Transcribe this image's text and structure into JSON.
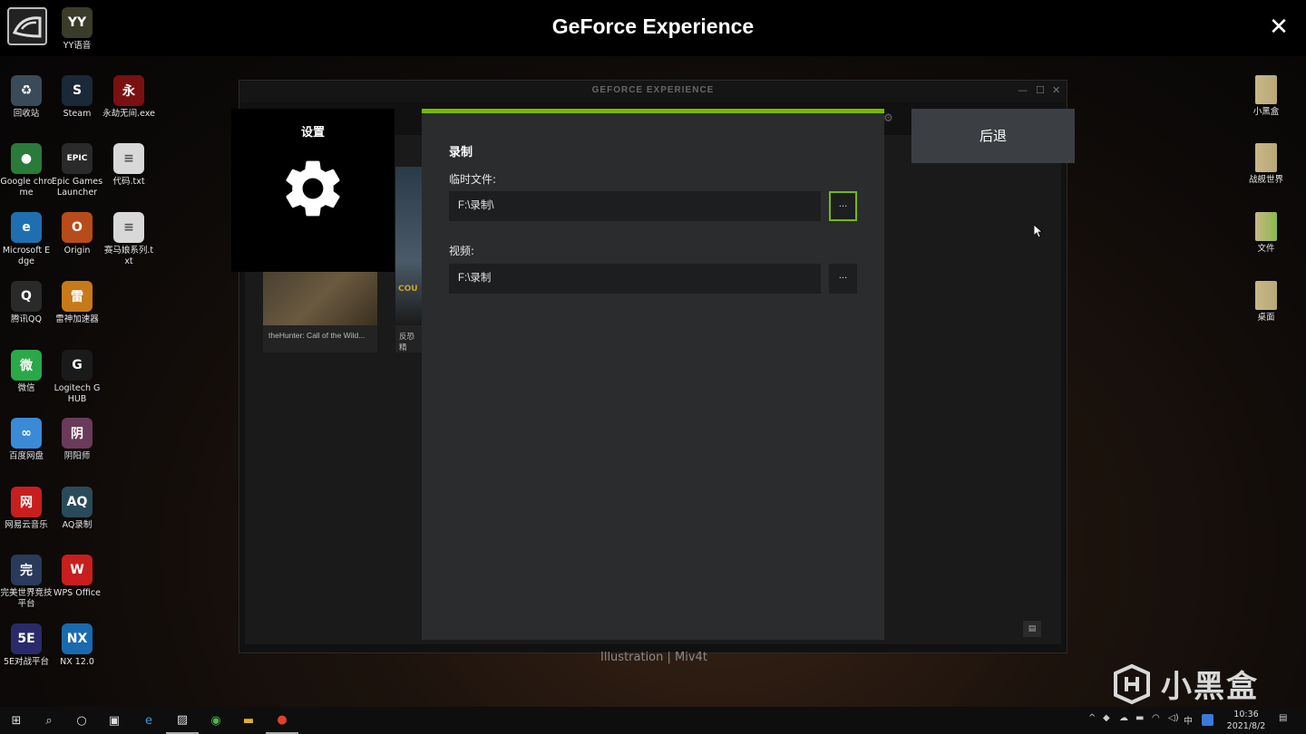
{
  "overlay": {
    "title": "GeForce Experience",
    "close_label": "✕"
  },
  "gfe_window": {
    "logo_text": "GEFORCE EXPERIENCE",
    "game_cards": [
      {
        "caption": "theHunter: Call of the Wild..."
      },
      {
        "caption": "反恐精",
        "art_text": "COU"
      }
    ]
  },
  "settings_panel": {
    "title": "设置"
  },
  "dialog": {
    "section_title": "录制",
    "temp_label": "临时文件:",
    "temp_value": "F:\\录制\\",
    "video_label": "视频:",
    "video_value": "F:\\录制",
    "browse_label": "..."
  },
  "back_button": {
    "label": "后退"
  },
  "desktop_icons_left": [
    {
      "label": "YY语音",
      "color": "#3b3b2a",
      "glyph": "YY"
    },
    {
      "label": "回收站",
      "color": "#3a4a58",
      "glyph": "♻"
    },
    {
      "label": "Steam",
      "color": "#1b2838",
      "glyph": "S"
    },
    {
      "label": "永劫无间.exe",
      "color": "#7a1010",
      "glyph": "永"
    },
    {
      "label": "Google chrome",
      "color": "#2a7a3a",
      "glyph": "●"
    },
    {
      "label": "Epic Games Launcher",
      "color": "#2a2a2a",
      "glyph": "EPIC"
    },
    {
      "label": "代码.txt",
      "color": "#d8d8d8",
      "glyph": "≡"
    },
    {
      "label": "Microsoft Edge",
      "color": "#1f6fb0",
      "glyph": "e"
    },
    {
      "label": "Origin",
      "color": "#b84b1a",
      "glyph": "O"
    },
    {
      "label": "赛马娘系列.txt",
      "color": "#d8d8d8",
      "glyph": "≡"
    },
    {
      "label": "腾讯QQ",
      "color": "#2a2a2a",
      "glyph": "Q"
    },
    {
      "label": "雷神加速器",
      "color": "#c77a1a",
      "glyph": "雷"
    },
    {
      "label": "微信",
      "color": "#2aa84a",
      "glyph": "微"
    },
    {
      "label": "Logitech G HUB",
      "color": "#1a1a1a",
      "glyph": "G"
    },
    {
      "label": "百度网盘",
      "color": "#3a8ad8",
      "glyph": "∞"
    },
    {
      "label": "阴阳师",
      "color": "#6a3a5a",
      "glyph": "阴"
    },
    {
      "label": "网易云音乐",
      "color": "#c81e1e",
      "glyph": "网"
    },
    {
      "label": "AQ录制",
      "color": "#2a4a5a",
      "glyph": "AQ"
    },
    {
      "label": "完美世界竞技平台",
      "color": "#2a3a5a",
      "glyph": "完"
    },
    {
      "label": "WPS Office",
      "color": "#c81e1e",
      "glyph": "W"
    },
    {
      "label": "5E对战平台",
      "color": "#2a2a6a",
      "glyph": "5E"
    },
    {
      "label": "NX 12.0",
      "color": "#1a6ab0",
      "glyph": "NX"
    }
  ],
  "desktop_icons_right": [
    {
      "label": "小黑盒",
      "color": "#b8a878",
      "glyph": ""
    },
    {
      "label": "战舰世界",
      "color": "#b8a878",
      "glyph": ""
    },
    {
      "label": "文件",
      "color": "#8ab84a",
      "glyph": ""
    },
    {
      "label": "桌面",
      "color": "#b8a878",
      "glyph": ""
    }
  ],
  "wallpaper": {
    "credit": "Illustration | Miv4t",
    "watermark": "小黑盒"
  },
  "taskbar": {
    "time": "10:36",
    "date": "2021/8/2",
    "ime": "中"
  }
}
